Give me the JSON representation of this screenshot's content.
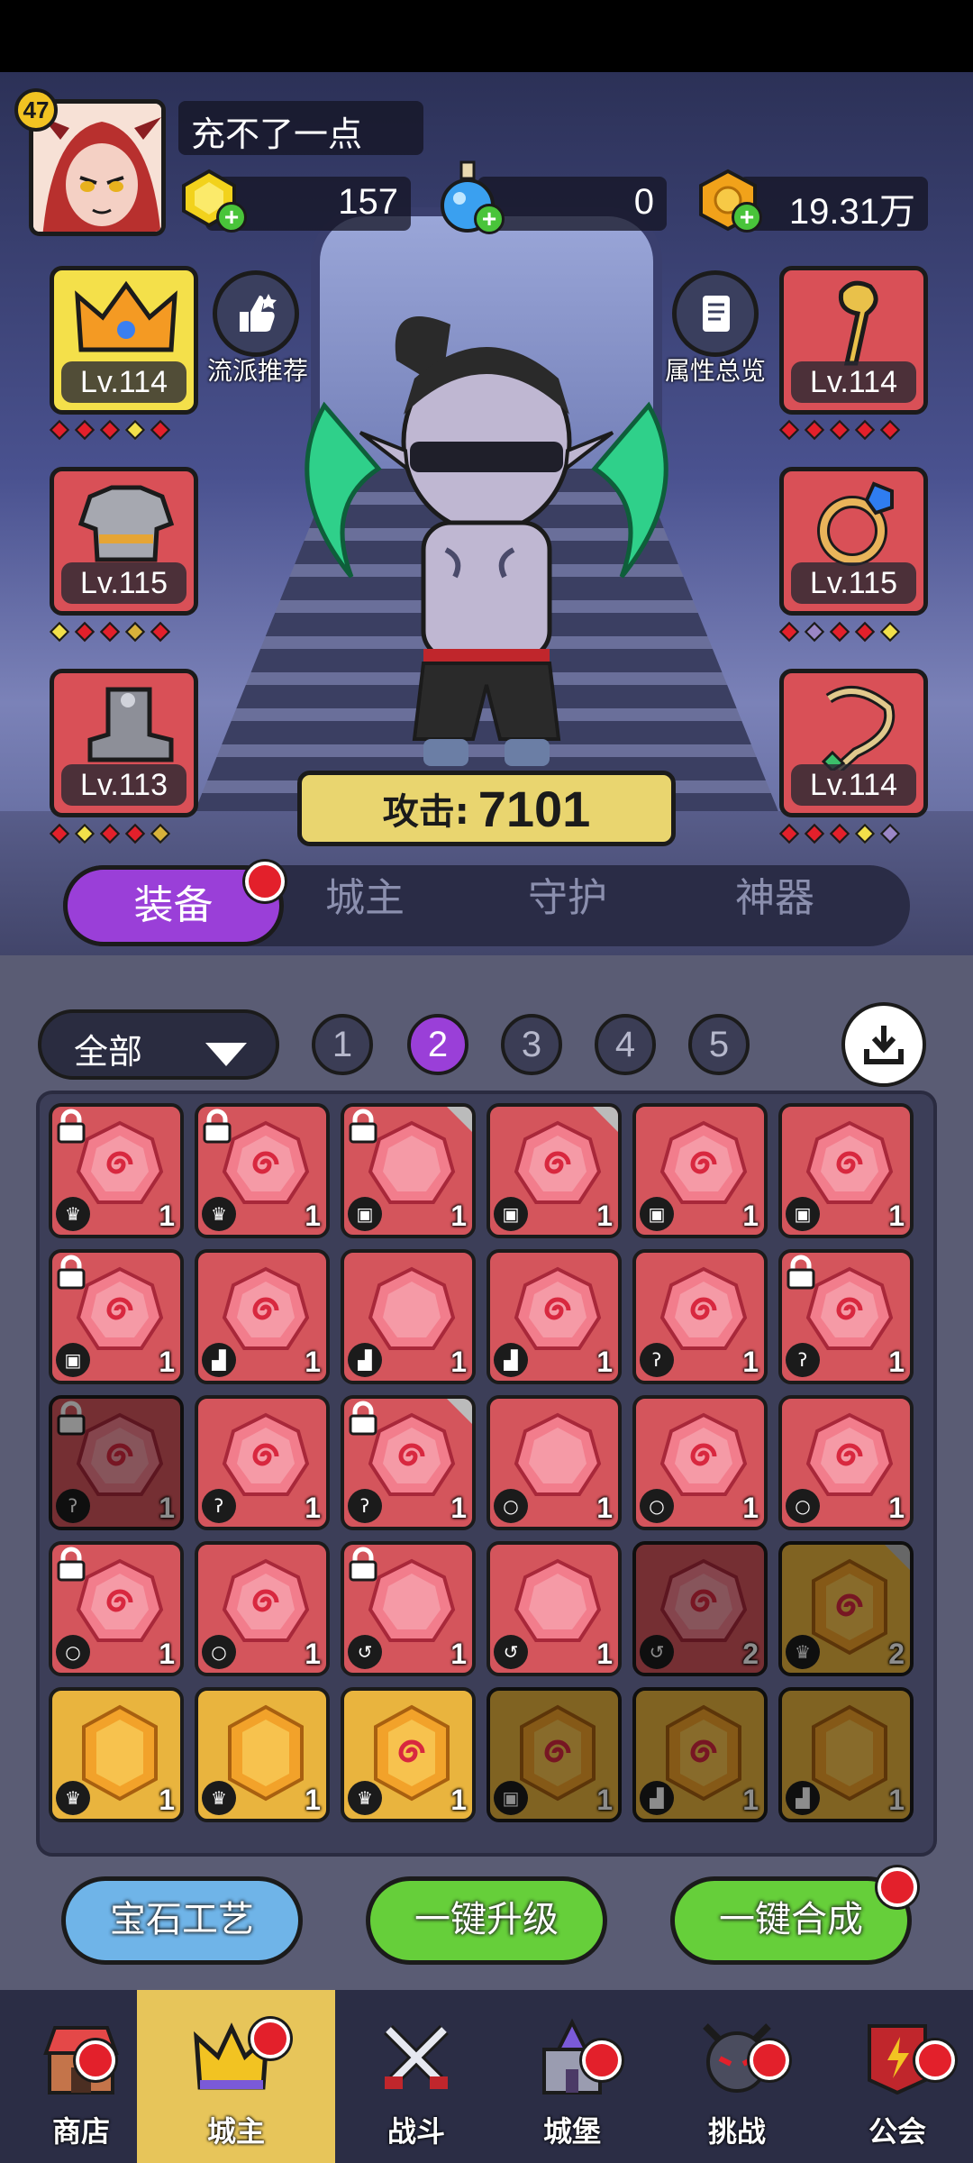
{
  "player": {
    "level": "47",
    "name": "充不了一点"
  },
  "currencies": {
    "diamond": {
      "value": "157",
      "icon": "gem-icon"
    },
    "potion": {
      "value": "0",
      "icon": "potion-icon"
    },
    "gold": {
      "value": "19.31万",
      "icon": "coin-icon"
    }
  },
  "side": {
    "recommend": "流派推荐",
    "overview": "属性总览"
  },
  "equipment": {
    "left": [
      {
        "name": "crown",
        "level": "Lv.114",
        "dots": [
          "#e3202b",
          "#e3202b",
          "#e3202b",
          "#f2e04a",
          "#e3202b"
        ]
      },
      {
        "name": "armor",
        "level": "Lv.115",
        "dots": [
          "#f2e04a",
          "#e3202b",
          "#e3202b",
          "#d8b23a",
          "#e3202b"
        ]
      },
      {
        "name": "boots",
        "level": "Lv.113",
        "dots": [
          "#e3202b",
          "#f2e04a",
          "#e3202b",
          "#e3202b",
          "#d8b23a"
        ]
      }
    ],
    "right": [
      {
        "name": "staff",
        "level": "Lv.114",
        "dots": [
          "#e3202b",
          "#e3202b",
          "#e3202b",
          "#e3202b",
          "#e3202b"
        ]
      },
      {
        "name": "ring",
        "level": "Lv.115",
        "dots": [
          "#e3202b",
          "#9a86c6",
          "#e3202b",
          "#e3202b",
          "#f2e04a"
        ]
      },
      {
        "name": "amulet",
        "level": "Lv.114",
        "dots": [
          "#e3202b",
          "#e3202b",
          "#e3202b",
          "#f2e04a",
          "#9a86c6"
        ]
      }
    ]
  },
  "attack": {
    "label": "攻击:",
    "value": "7101"
  },
  "tabs": [
    "装备",
    "城主",
    "守护",
    "神器"
  ],
  "filter": {
    "label": "全部"
  },
  "pages": [
    "1",
    "2",
    "3",
    "4",
    "5"
  ],
  "gems": [
    {
      "c": "r",
      "t": "♛",
      "n": "1",
      "lock": true
    },
    {
      "c": "r",
      "t": "♛",
      "n": "1",
      "lock": true
    },
    {
      "c": "r",
      "t": "▣",
      "n": "1",
      "lock": true,
      "corner": true,
      "plain": true
    },
    {
      "c": "r",
      "t": "▣",
      "n": "1",
      "corner": true
    },
    {
      "c": "r",
      "t": "▣",
      "n": "1"
    },
    {
      "c": "r",
      "t": "▣",
      "n": "1"
    },
    {
      "c": "r",
      "t": "▣",
      "n": "1",
      "lock": true
    },
    {
      "c": "r",
      "t": "▟",
      "n": "1"
    },
    {
      "c": "r",
      "t": "▟",
      "n": "1",
      "plain": true
    },
    {
      "c": "r",
      "t": "▟",
      "n": "1"
    },
    {
      "c": "r",
      "t": "ʔ",
      "n": "1"
    },
    {
      "c": "r",
      "t": "ʔ",
      "n": "1",
      "lock": true
    },
    {
      "c": "r",
      "t": "ʔ",
      "n": "1",
      "lock": true,
      "dim": true
    },
    {
      "c": "r",
      "t": "ʔ",
      "n": "1"
    },
    {
      "c": "r",
      "t": "ʔ",
      "n": "1",
      "lock": true,
      "corner": true
    },
    {
      "c": "r",
      "t": "○",
      "n": "1",
      "plain": true
    },
    {
      "c": "r",
      "t": "○",
      "n": "1"
    },
    {
      "c": "r",
      "t": "○",
      "n": "1"
    },
    {
      "c": "r",
      "t": "○",
      "n": "1",
      "lock": true
    },
    {
      "c": "r",
      "t": "○",
      "n": "1"
    },
    {
      "c": "r",
      "t": "↺",
      "n": "1",
      "lock": true,
      "plain": true
    },
    {
      "c": "r",
      "t": "↺",
      "n": "1",
      "plain": true
    },
    {
      "c": "r",
      "t": "↺",
      "n": "2",
      "dim": true
    },
    {
      "c": "o",
      "t": "♛",
      "n": "2",
      "dim": true,
      "corner": true
    },
    {
      "c": "o",
      "t": "♛",
      "n": "1",
      "plain": true
    },
    {
      "c": "o",
      "t": "♛",
      "n": "1",
      "plain": true
    },
    {
      "c": "o",
      "t": "♛",
      "n": "1"
    },
    {
      "c": "o",
      "t": "▣",
      "n": "1",
      "dim": true
    },
    {
      "c": "o",
      "t": "▟",
      "n": "1",
      "dim": true
    },
    {
      "c": "o",
      "t": "▟",
      "n": "1",
      "dim": true,
      "plain": true
    }
  ],
  "actions": {
    "craft": "宝石工艺",
    "upgrade": "一键升级",
    "merge": "一键合成"
  },
  "nav": [
    "商店",
    "城主",
    "战斗",
    "城堡",
    "挑战",
    "公会"
  ],
  "colors": {
    "tab_active": "#9a3fd8",
    "gem_red": "#d4555c",
    "gem_orange": "#e9b43e",
    "nav_active": "#e7c55a"
  }
}
